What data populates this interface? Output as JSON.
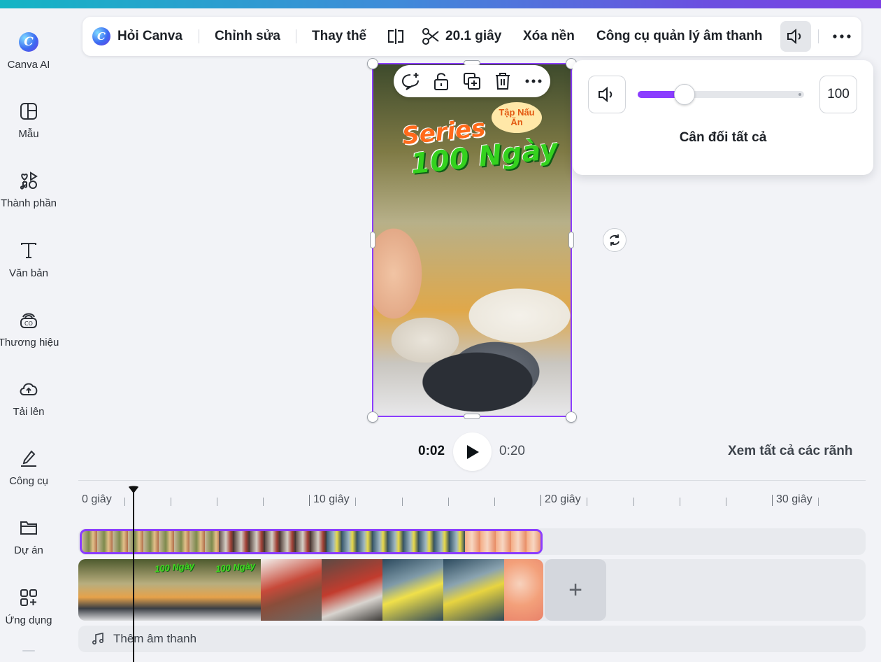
{
  "sidebar": {
    "items": [
      {
        "label": "Canva AI",
        "icon": "canva-ai-icon"
      },
      {
        "label": "Mẫu",
        "icon": "template-icon"
      },
      {
        "label": "Thành phần",
        "icon": "elements-icon"
      },
      {
        "label": "Văn bản",
        "icon": "text-icon"
      },
      {
        "label": "Thương hiệu",
        "icon": "brand-icon"
      },
      {
        "label": "Tải lên",
        "icon": "upload-icon"
      },
      {
        "label": "Công cụ",
        "icon": "tools-icon"
      },
      {
        "label": "Dự án",
        "icon": "folder-icon"
      },
      {
        "label": "Ứng dụng",
        "icon": "apps-icon"
      }
    ]
  },
  "toolbar": {
    "ask_canva": "Hỏi Canva",
    "edit": "Chỉnh sửa",
    "replace": "Thay thế",
    "duration": "20.1 giây",
    "remove_bg": "Xóa nền",
    "audio_manager": "Công cụ quản lý âm thanh"
  },
  "video": {
    "title_line1": "Series",
    "title_line2": "100 Ngày",
    "bubble_text": "Tập Nấu Ăn"
  },
  "volume": {
    "value": 100,
    "display": "100",
    "balance_label": "Cân đối tất cả",
    "accent": "#8b3dff"
  },
  "playback": {
    "current": "0:02",
    "total": "0:20",
    "see_all_tracks": "Xem tất cả các rãnh"
  },
  "ruler": {
    "labels": [
      "0 giây",
      "10 giây",
      "20 giây",
      "30 giây"
    ]
  },
  "clips": {
    "mini_title": "100 Ngày",
    "add_audio": "Thêm âm thanh",
    "add_button": "+"
  }
}
